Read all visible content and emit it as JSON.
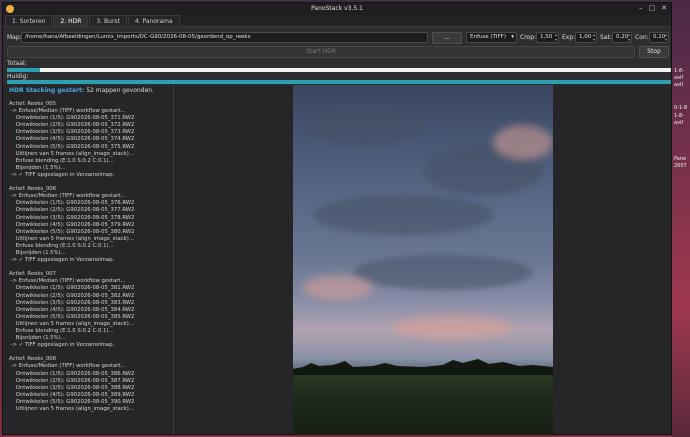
{
  "window": {
    "title": "PanoStack v3.5.1",
    "controls": [
      "–",
      "▢",
      "✕"
    ]
  },
  "tabs": [
    {
      "label": "1. Sorteren",
      "active": false
    },
    {
      "label": "2. HDR",
      "active": true
    },
    {
      "label": "3. Burst",
      "active": false
    },
    {
      "label": "4. Panorama",
      "active": false
    }
  ],
  "toolbar": {
    "map_label": "Map:",
    "map_value": "/home/hans/Afbeeldingen/Lumix_Imports/DC-G90/2026-08-05/geordend_op_reeks",
    "browse_label": "...",
    "method_value": "Enfuse (TIFF)",
    "crop_label": "Crop:",
    "crop_value": "1,50",
    "exp_label": "Exp:",
    "exp_value": "1,00",
    "sat_label": "Sat:",
    "sat_value": "0,20",
    "con_label": "Con:",
    "con_value": "0,10",
    "start_label": "Start HDR",
    "stop_label": "Stop"
  },
  "progress": {
    "total_label": "Totaal:",
    "total_fraction": 0.05,
    "current_label": "Huidig:",
    "current_fraction": 1.0
  },
  "log": {
    "status_title": "HDR Stacking gestart:",
    "status_detail": " 52 mappen gevonden.",
    "text": "Actief: Reeks_005\n -> Enfuse/Median (TIFF) workflow gestart...\n    Ontwikkelen (1/5): G902026-08-05_371.RW2\n    Ontwikkelen (2/5): G902026-08-05_372.RW2\n    Ontwikkelen (3/5): G902026-08-05_373.RW2\n    Ontwikkelen (4/5): G902026-08-05_374.RW2\n    Ontwikkelen (5/5): G902026-08-05_375.RW2\n    Uitlijnen van 5 frames (align_image_stack)...\n    Enfuse blending (E:1.0 S:0.2 C:0.1)...\n    Bijsnijden (1.5%)...\n -> ✓ TIFF opgeslagen in Verzamelmap.\n\nActief: Reeks_006\n -> Enfuse/Median (TIFF) workflow gestart...\n    Ontwikkelen (1/5): G902026-08-05_376.RW2\n    Ontwikkelen (2/5): G902026-08-05_377.RW2\n    Ontwikkelen (3/5): G902026-08-05_378.RW2\n    Ontwikkelen (4/5): G902026-08-05_379.RW2\n    Ontwikkelen (5/5): G902026-08-05_380.RW2\n    Uitlijnen van 5 frames (align_image_stack)...\n    Enfuse blending (E:1.0 S:0.2 C:0.1)...\n    Bijsnijden (1.5%)...\n -> ✓ TIFF opgeslagen in Verzamelmap.\n\nActief: Reeks_007\n -> Enfuse/Median (TIFF) workflow gestart...\n    Ontwikkelen (1/5): G902026-08-05_381.RW2\n    Ontwikkelen (2/5): G902026-08-05_382.RW2\n    Ontwikkelen (3/5): G902026-08-05_383.RW2\n    Ontwikkelen (4/5): G902026-08-05_384.RW2\n    Ontwikkelen (5/5): G902026-08-05_385.RW2\n    Uitlijnen van 5 frames (align_image_stack)...\n    Enfuse blending (E:1.0 S:0.2 C:0.1)...\n    Bijsnijden (1.5%)...\n -> ✓ TIFF opgeslagen in Verzamelmap.\n\nActief: Reeks_008\n -> Enfuse/Median (TIFF) workflow gestart...\n    Ontwikkelen (1/5): G902026-08-05_386.RW2\n    Ontwikkelen (2/5): G902026-08-05_387.RW2\n    Ontwikkelen (3/5): G902026-08-05_388.RW2\n    Ontwikkelen (4/5): G902026-08-05_389.RW2\n    Ontwikkelen (5/5): G902026-08-05_390.RW2\n    Uitlijnen van 5 frames (align_image_stack)..."
  },
  "desktop": {
    "labels": [
      "1-8-",
      "avif",
      "1-8-",
      "avif",
      "0-1-8",
      "avif",
      "Pane",
      "2607"
    ]
  },
  "colors": {
    "accent": "#2aa0b0",
    "status": "#4aa8e8"
  }
}
